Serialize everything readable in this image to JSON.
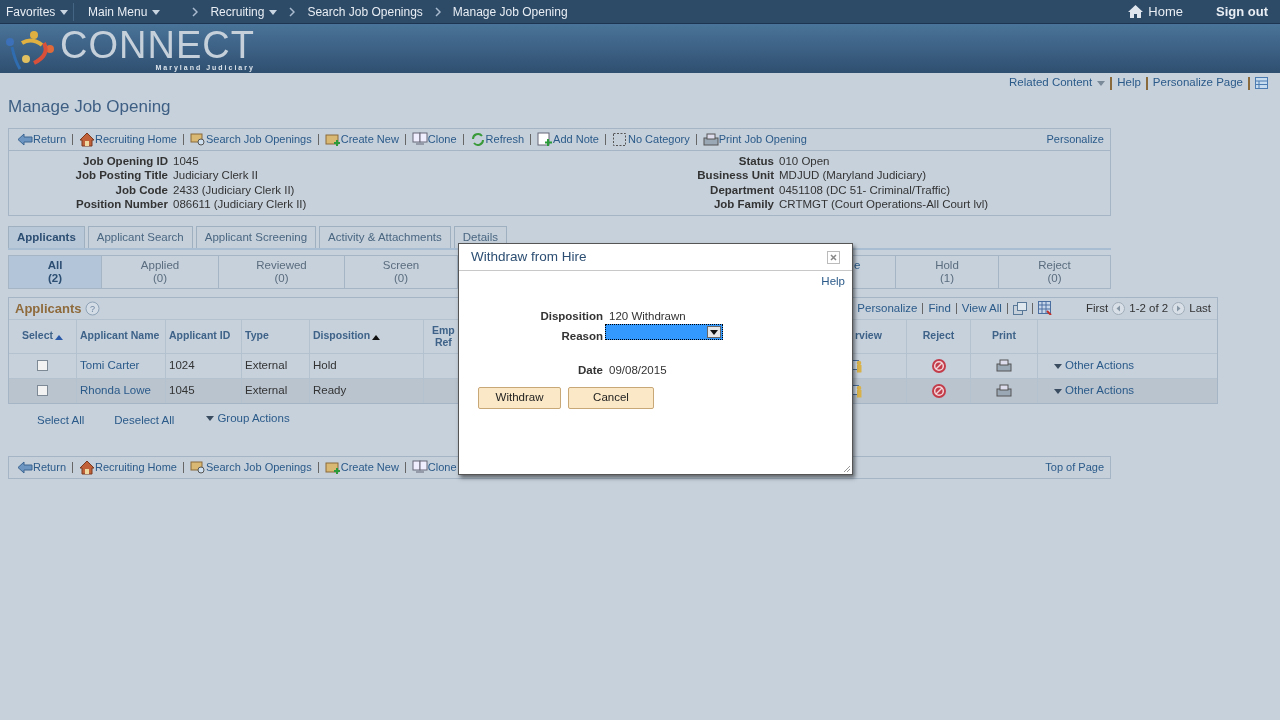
{
  "top_nav": {
    "favorites": "Favorites",
    "breadcrumbs": [
      {
        "label": "Main Menu",
        "dropdown": true
      },
      {
        "label": "Recruiting",
        "dropdown": true
      },
      {
        "label": "Search Job Openings",
        "dropdown": false
      },
      {
        "label": "Manage Job Opening",
        "dropdown": false
      }
    ],
    "home": "Home",
    "sign_out": "Sign out"
  },
  "banner": {
    "logo_text": "CONNECT",
    "logo_subtitle": "Maryland Judiciary"
  },
  "page_links": [
    {
      "label": "Related Content",
      "dropdown": true
    },
    {
      "label": "Help",
      "dropdown": false
    },
    {
      "label": "Personalize Page",
      "dropdown": false
    }
  ],
  "page_title": "Manage Job Opening",
  "toolbar": {
    "items": [
      {
        "label": "Return",
        "kind": "return"
      },
      {
        "label": "Recruiting Home",
        "kind": "home"
      },
      {
        "label": "Search Job Openings",
        "kind": "search"
      },
      {
        "label": "Create New",
        "kind": "create"
      },
      {
        "label": "Clone",
        "kind": "clone"
      },
      {
        "label": "Refresh",
        "kind": "refresh"
      },
      {
        "label": "Add Note",
        "kind": "note"
      },
      {
        "label": "No Category",
        "kind": "category"
      },
      {
        "label": "Print Job Opening",
        "kind": "print"
      }
    ],
    "personalize": "Personalize"
  },
  "job_details": {
    "left": [
      {
        "label": "Job Opening ID",
        "value": "1045"
      },
      {
        "label": "Job Posting Title",
        "value": "Judiciary Clerk II"
      },
      {
        "label": "Job Code",
        "value": "2433 (Judiciary Clerk II)"
      },
      {
        "label": "Position Number",
        "value": "086611 (Judiciary Clerk II)"
      }
    ],
    "right": [
      {
        "label": "Status",
        "value": "010 Open"
      },
      {
        "label": "Business Unit",
        "value": "MDJUD (Maryland Judiciary)"
      },
      {
        "label": "Department",
        "value": "0451108 (DC 51- Criminal/Traffic)"
      },
      {
        "label": "Job Family",
        "value": "CRTMGT (Court Operations-All Court lvl)"
      }
    ]
  },
  "tabs": [
    {
      "label": "Applicants",
      "selected": true
    },
    {
      "label": "Applicant Search",
      "selected": false
    },
    {
      "label": "Applicant Screening",
      "selected": false
    },
    {
      "label": "Activity & Attachments",
      "selected": false
    },
    {
      "label": "Details",
      "selected": false
    }
  ],
  "status_tabs": [
    {
      "label": "All",
      "count": "(2)",
      "selected": true
    },
    {
      "label": "Applied",
      "count": "(0)",
      "selected": false
    },
    {
      "label": "Reviewed",
      "count": "(0)",
      "selected": false
    },
    {
      "label": "Screen",
      "count": "(0)",
      "selected": false
    },
    {
      "label": "e",
      "selected": false,
      "partial": true
    },
    {
      "label": "Hold",
      "count": "(1)",
      "selected": false
    },
    {
      "label": "Reject",
      "count": "(0)",
      "selected": false
    }
  ],
  "applicants": {
    "title": "Applicants",
    "help_icon": "?",
    "links": [
      "Personalize",
      "Find",
      "View All"
    ],
    "first": "First",
    "range": "1-2 of 2",
    "last": "Last",
    "columns": [
      {
        "label": "Select",
        "sorted": true
      },
      {
        "label": "Applicant Name",
        "sorted": false
      },
      {
        "label": "Applicant ID",
        "sorted": false
      },
      {
        "label": "Type",
        "sorted": false
      },
      {
        "label": "Disposition",
        "sorted": true
      },
      {
        "label": "Emp",
        "label2": "Ref",
        "sorted": false
      },
      {
        "label": "rview",
        "sorted": false
      },
      {
        "label": "Reject",
        "sorted": false
      },
      {
        "label": "Print",
        "sorted": false
      }
    ],
    "rows": [
      {
        "checked": false,
        "name": "Tomi Carter",
        "id": "1024",
        "type": "External",
        "disposition": "Hold",
        "other_actions": "Other Actions"
      },
      {
        "checked": false,
        "name": "Rhonda Lowe",
        "id": "1045",
        "type": "External",
        "disposition": "Ready",
        "other_actions": "Other Actions"
      }
    ],
    "select_all": "Select All",
    "deselect_all": "Deselect All",
    "group_actions": "Group Actions"
  },
  "bottom_toolbar": {
    "items": [
      {
        "label": "Return",
        "kind": "return"
      },
      {
        "label": "Recruiting Home",
        "kind": "home"
      },
      {
        "label": "Search Job Openings",
        "kind": "search"
      },
      {
        "label": "Create New",
        "kind": "create"
      },
      {
        "label": "Clone",
        "kind": "clone"
      }
    ],
    "top_of_page": "Top of Page"
  },
  "modal": {
    "title": "Withdraw from Hire",
    "help": "Help",
    "fields": [
      {
        "label": "Disposition",
        "value": "120 Withdrawn",
        "kind": "text"
      },
      {
        "label": "Reason",
        "kind": "select"
      },
      {
        "label": "Date",
        "value": "09/08/2015",
        "kind": "text"
      }
    ],
    "buttons": [
      "Withdraw",
      "Cancel"
    ]
  }
}
